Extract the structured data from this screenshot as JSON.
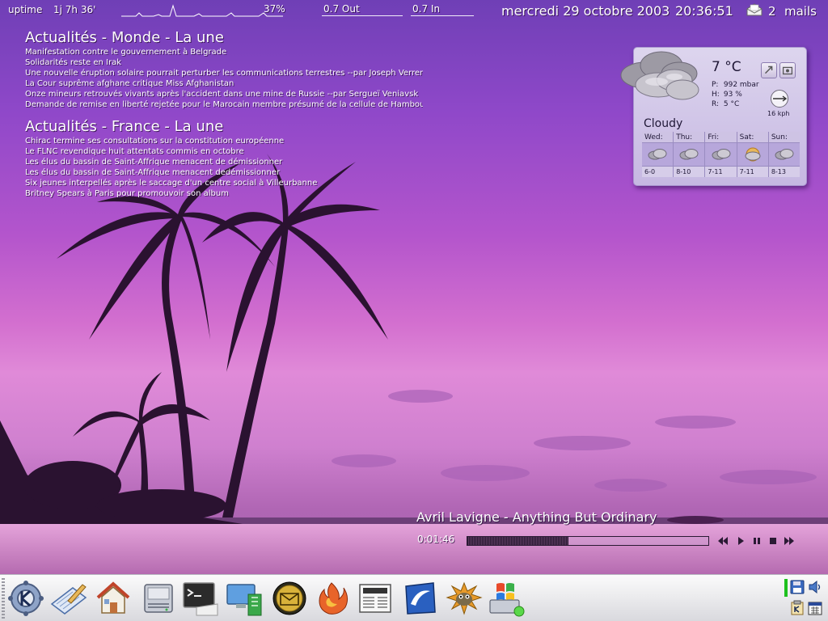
{
  "topbar": {
    "uptime_label": "uptime",
    "uptime_value": "1j 7h 36'",
    "cpu": "37%",
    "net_out": "0.7 Out",
    "net_in": "0.7 In",
    "date": "mercredi 29 octobre 2003",
    "time": "20:36:51",
    "mail_count": "2",
    "mail_label": "mails"
  },
  "news": {
    "monde": {
      "title": "Actualités - Monde - La une",
      "items": [
        "Manifestation contre le gouvernement à Belgrade",
        "Solidarités reste en Irak",
        "Une nouvelle éruption solaire pourrait perturber les communications terrestres --par Joseph Verreng",
        "La Cour suprême afghane critique Miss Afghanistan",
        "Onze mineurs retrouvés vivants après l'accident dans une mine de Russie --par Sergueï Veniavsk",
        "Demande de remise en liberté rejetée pour le Marocain membre présumé de la cellule de Hambou"
      ]
    },
    "france": {
      "title": "Actualités - France - La une",
      "items": [
        "Chirac termine ses consultations sur la constitution européenne",
        "Le FLNC revendique huit attentats commis en octobre",
        "Les élus du bassin de Saint-Affrique menacent de démissionner",
        "Les élus du bassin de Saint-Affrique menacent dedémissionner",
        "Six jeunes interpellés après le saccage d'un centre social à Villeurbanne",
        "Britney Spears à Paris pour promouvoir son album"
      ]
    }
  },
  "weather": {
    "temperature": "7 °C",
    "pressure_label": "P:",
    "pressure": "992 mbar",
    "humidity_label": "H:",
    "humidity": "93 %",
    "realfeel_label": "R:",
    "realfeel": "5 °C",
    "wind": "16 kph",
    "condition": "Cloudy",
    "icon": "cloudy-icon",
    "forecast": [
      {
        "day": "Wed:",
        "range": "6-0",
        "icon": "cloudy-icon"
      },
      {
        "day": "Thu:",
        "range": "8-10",
        "icon": "cloudy-icon"
      },
      {
        "day": "Fri:",
        "range": "7-11",
        "icon": "cloudy-icon"
      },
      {
        "day": "Sat:",
        "range": "7-11",
        "icon": "partly-sunny-icon"
      },
      {
        "day": "Sun:",
        "range": "8-13",
        "icon": "cloudy-icon"
      }
    ]
  },
  "player": {
    "title": "Avril Lavigne - Anything But Ordinary",
    "elapsed": "0:01:46",
    "progress": 0.42,
    "buttons": [
      "rewind-icon",
      "play-icon",
      "pause-icon",
      "stop-icon",
      "fast-forward-icon"
    ]
  },
  "taskbar": {
    "launchers": [
      "kde-menu-icon",
      "text-editor-icon",
      "home-folder-icon",
      "hard-drive-icon",
      "terminal-icon",
      "network-monitor-icon",
      "mail-client-icon",
      "firefox-icon",
      "news-reader-icon",
      "office-icon",
      "gimp-icon",
      "windows-partition-icon"
    ],
    "tray": [
      "floppy-icon",
      "volume-icon",
      "klipper-icon",
      "calendar-icon"
    ]
  },
  "colors": {
    "accent": "#b066d0",
    "weather_panel": "#c6b8e2",
    "taskbar": "#e6e6ea"
  }
}
